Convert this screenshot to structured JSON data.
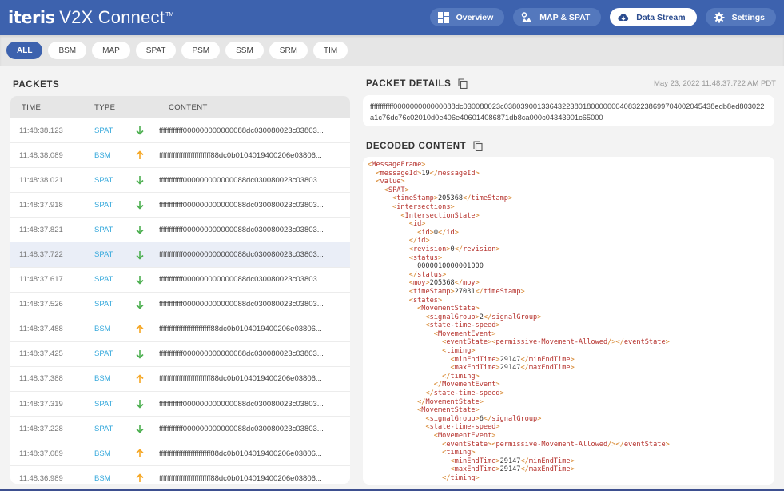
{
  "app": {
    "logo": "iteris",
    "product": "V2X Connect",
    "trademark": "TM"
  },
  "nav": [
    {
      "label": "Overview",
      "icon": "dashboard-icon",
      "active": false
    },
    {
      "label": "MAP & SPAT",
      "icon": "map-pin-icon",
      "active": false
    },
    {
      "label": "Data Stream",
      "icon": "cloud-download-icon",
      "active": true
    },
    {
      "label": "Settings",
      "icon": "gear-icon",
      "active": false
    }
  ],
  "filters": [
    {
      "label": "ALL",
      "active": true
    },
    {
      "label": "BSM",
      "active": false
    },
    {
      "label": "MAP",
      "active": false
    },
    {
      "label": "SPAT",
      "active": false
    },
    {
      "label": "PSM",
      "active": false
    },
    {
      "label": "SSM",
      "active": false
    },
    {
      "label": "SRM",
      "active": false
    },
    {
      "label": "TIM",
      "active": false
    }
  ],
  "packets": {
    "title": "PACKETS",
    "columns": {
      "time": "TIME",
      "type": "TYPE",
      "content": "CONTENT"
    },
    "rows": [
      {
        "time": "11:48:38.123",
        "type": "SPAT",
        "direction": "down",
        "content": "ffffffffffff000000000000088dc030080023c03803..."
      },
      {
        "time": "11:48:38.089",
        "type": "BSM",
        "direction": "up",
        "content": "ffffffffffffffffffffffffff88dc0b0104019400206e03806..."
      },
      {
        "time": "11:48:38.021",
        "type": "SPAT",
        "direction": "down",
        "content": "ffffffffffff000000000000088dc030080023c03803..."
      },
      {
        "time": "11:48:37.918",
        "type": "SPAT",
        "direction": "down",
        "content": "ffffffffffff000000000000088dc030080023c03803..."
      },
      {
        "time": "11:48:37.821",
        "type": "SPAT",
        "direction": "down",
        "content": "ffffffffffff000000000000088dc030080023c03803..."
      },
      {
        "time": "11:48:37.722",
        "type": "SPAT",
        "direction": "down",
        "content": "ffffffffffff000000000000088dc030080023c03803...",
        "selected": true
      },
      {
        "time": "11:48:37.617",
        "type": "SPAT",
        "direction": "down",
        "content": "ffffffffffff000000000000088dc030080023c03803..."
      },
      {
        "time": "11:48:37.526",
        "type": "SPAT",
        "direction": "down",
        "content": "ffffffffffff000000000000088dc030080023c03803..."
      },
      {
        "time": "11:48:37.488",
        "type": "BSM",
        "direction": "up",
        "content": "ffffffffffffffffffffffffff88dc0b0104019400206e03806..."
      },
      {
        "time": "11:48:37.425",
        "type": "SPAT",
        "direction": "down",
        "content": "ffffffffffff000000000000088dc030080023c03803..."
      },
      {
        "time": "11:48:37.388",
        "type": "BSM",
        "direction": "up",
        "content": "ffffffffffffffffffffffffff88dc0b0104019400206e03806..."
      },
      {
        "time": "11:48:37.319",
        "type": "SPAT",
        "direction": "down",
        "content": "ffffffffffff000000000000088dc030080023c03803..."
      },
      {
        "time": "11:48:37.228",
        "type": "SPAT",
        "direction": "down",
        "content": "ffffffffffff000000000000088dc030080023c03803..."
      },
      {
        "time": "11:48:37.089",
        "type": "BSM",
        "direction": "up",
        "content": "ffffffffffffffffffffffffff88dc0b0104019400206e03806..."
      },
      {
        "time": "11:48:36.989",
        "type": "BSM",
        "direction": "up",
        "content": "ffffffffffffffffffffffffff88dc0b0104019400206e03806..."
      }
    ]
  },
  "details": {
    "title": "PACKET DETAILS",
    "timestamp": "May 23, 2022 11:48:37.722 AM PDT",
    "raw": "ffffffffffff000000000000088dc030080023c038039001336432238018000000040832238699704002045438edb8ed803022a1c76dc76c02010d0e406e406014086871db8ca000c04343901c65000"
  },
  "decoded": {
    "title": "DECODED CONTENT",
    "lines": [
      {
        "indent": 0,
        "kind": "open",
        "tag": "MessageFrame"
      },
      {
        "indent": 1,
        "kind": "leaf",
        "tag": "messageId",
        "value": "19"
      },
      {
        "indent": 1,
        "kind": "open",
        "tag": "value"
      },
      {
        "indent": 2,
        "kind": "open",
        "tag": "SPAT"
      },
      {
        "indent": 3,
        "kind": "leaf",
        "tag": "timeStamp",
        "value": "205368"
      },
      {
        "indent": 3,
        "kind": "open",
        "tag": "intersections"
      },
      {
        "indent": 4,
        "kind": "open",
        "tag": "IntersectionState"
      },
      {
        "indent": 5,
        "kind": "open",
        "tag": "id"
      },
      {
        "indent": 6,
        "kind": "leaf",
        "tag": "id",
        "value": "0"
      },
      {
        "indent": 5,
        "kind": "close",
        "tag": "id"
      },
      {
        "indent": 5,
        "kind": "leaf",
        "tag": "revision",
        "value": "0"
      },
      {
        "indent": 5,
        "kind": "open",
        "tag": "status"
      },
      {
        "indent": 6,
        "kind": "text",
        "value": "0000010000001000"
      },
      {
        "indent": 5,
        "kind": "close",
        "tag": "status"
      },
      {
        "indent": 5,
        "kind": "leaf",
        "tag": "moy",
        "value": "205368"
      },
      {
        "indent": 5,
        "kind": "leaf",
        "tag": "timeStamp",
        "value": "27031"
      },
      {
        "indent": 5,
        "kind": "open",
        "tag": "states"
      },
      {
        "indent": 6,
        "kind": "open",
        "tag": "MovementState"
      },
      {
        "indent": 7,
        "kind": "leaf",
        "tag": "signalGroup",
        "value": "2"
      },
      {
        "indent": 7,
        "kind": "open",
        "tag": "state-time-speed"
      },
      {
        "indent": 8,
        "kind": "open",
        "tag": "MovementEvent"
      },
      {
        "indent": 9,
        "kind": "leaf-empty",
        "tag": "eventState",
        "inner": "permissive-Movement-Allowed"
      },
      {
        "indent": 9,
        "kind": "open",
        "tag": "timing"
      },
      {
        "indent": 10,
        "kind": "leaf",
        "tag": "minEndTime",
        "value": "29147"
      },
      {
        "indent": 10,
        "kind": "leaf",
        "tag": "maxEndTime",
        "value": "29147"
      },
      {
        "indent": 9,
        "kind": "close",
        "tag": "timing"
      },
      {
        "indent": 8,
        "kind": "close",
        "tag": "MovementEvent"
      },
      {
        "indent": 7,
        "kind": "close",
        "tag": "state-time-speed"
      },
      {
        "indent": 6,
        "kind": "close",
        "tag": "MovementState"
      },
      {
        "indent": 6,
        "kind": "open",
        "tag": "MovementState"
      },
      {
        "indent": 7,
        "kind": "leaf",
        "tag": "signalGroup",
        "value": "6"
      },
      {
        "indent": 7,
        "kind": "open",
        "tag": "state-time-speed"
      },
      {
        "indent": 8,
        "kind": "open",
        "tag": "MovementEvent"
      },
      {
        "indent": 9,
        "kind": "leaf-empty",
        "tag": "eventState",
        "inner": "permissive-Movement-Allowed"
      },
      {
        "indent": 9,
        "kind": "open",
        "tag": "timing"
      },
      {
        "indent": 10,
        "kind": "leaf",
        "tag": "minEndTime",
        "value": "29147"
      },
      {
        "indent": 10,
        "kind": "leaf",
        "tag": "maxEndTime",
        "value": "29147"
      },
      {
        "indent": 9,
        "kind": "close",
        "tag": "timing"
      }
    ]
  },
  "colors": {
    "brand": "#3d62ae",
    "type_link": "#37a9dc",
    "arrow_down": "#4caf50",
    "arrow_up": "#f5a623",
    "xml_tag": "#b5312c",
    "xml_bracket": "#d7862e"
  }
}
